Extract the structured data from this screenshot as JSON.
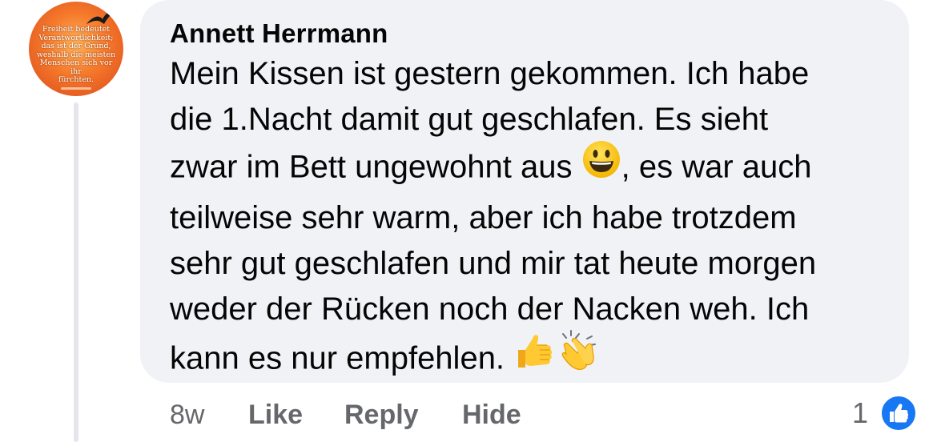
{
  "comment": {
    "avatar": {
      "icon": "sunset-bird-quote-avatar",
      "quote_text": "Freiheit bedeutet\nVerantwortlichkeit;\ndas ist der Grund,\nweshalb die meisten\nMenschen sich vor ihr\nfürchten."
    },
    "author": "Annett Herrmann",
    "body_lines": [
      "Mein Kissen ist gestern gekommen. Ich habe",
      "die 1.Nacht damit gut geschlafen. Es sieht",
      "zwar im Bett ungewohnt aus",
      ", es war auch",
      "teilweise sehr warm, aber ich habe trotzdem",
      "sehr gut geschlafen und mir tat heute morgen",
      "weder der Rücken noch der Nacken weh. Ich",
      "kann es nur empfehlen."
    ],
    "emojis": [
      "grinning-face",
      "thumbs-up",
      "clapping-hands"
    ],
    "actions": {
      "time": "8w",
      "like": "Like",
      "reply": "Reply",
      "hide": "Hide"
    },
    "reactions": {
      "count": "1",
      "type": "like-icon",
      "color": "#1877f2"
    }
  }
}
